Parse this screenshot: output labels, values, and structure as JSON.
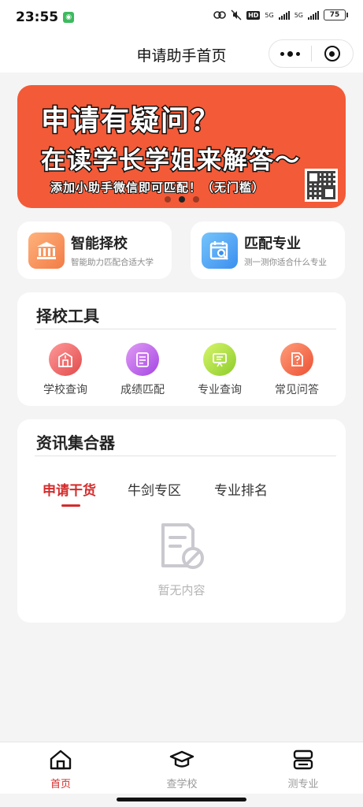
{
  "status_bar": {
    "time": "23:55",
    "network_1": "5G",
    "network_2": "5G",
    "hd": "HD",
    "battery": "75"
  },
  "nav": {
    "title": "申请助手首页"
  },
  "banner": {
    "line1": "申请有疑问？",
    "line2": "在读学长学姐来解答～",
    "line3": "添加小助手微信即可匹配！（无门槛）",
    "slide_count": 3,
    "active_slide": 2
  },
  "quick_cards": [
    {
      "title": "智能择校",
      "subtitle": "智能助力匹配合适大学",
      "icon": "school-building-icon"
    },
    {
      "title": "匹配专业",
      "subtitle": "测一测你适合什么专业",
      "icon": "calendar-search-icon"
    }
  ],
  "tools": {
    "title": "择校工具",
    "items": [
      {
        "label": "学校查询",
        "icon": "school-icon"
      },
      {
        "label": "成绩匹配",
        "icon": "clipboard-icon"
      },
      {
        "label": "专业查询",
        "icon": "board-icon"
      },
      {
        "label": "常见问答",
        "icon": "question-doc-icon"
      }
    ]
  },
  "news": {
    "title": "资讯集合器",
    "tabs": [
      "申请干货",
      "牛剑专区",
      "专业排名"
    ],
    "active_tab": 0,
    "empty_text": "暂无内容"
  },
  "tab_bar": {
    "items": [
      {
        "label": "首页",
        "icon": "home-icon",
        "active": true
      },
      {
        "label": "查学校",
        "icon": "graduation-cap-icon",
        "active": false
      },
      {
        "label": "测专业",
        "icon": "layers-icon",
        "active": false
      }
    ]
  },
  "colors": {
    "accent": "#d42b2b",
    "banner": "#f35a37"
  }
}
